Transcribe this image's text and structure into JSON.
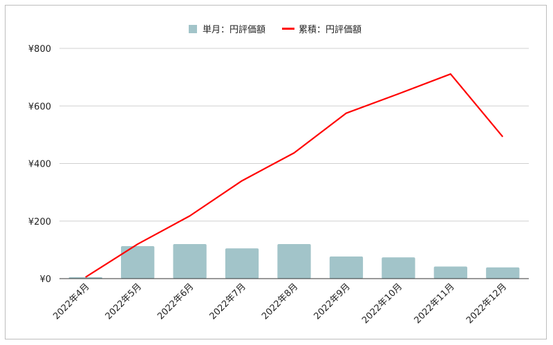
{
  "chart_data": {
    "type": "bar",
    "categories": [
      "2022年4月",
      "2022年5月",
      "2022年6月",
      "2022年7月",
      "2022年8月",
      "2022年9月",
      "2022年10月",
      "2022年11月",
      "2022年12月"
    ],
    "series": [
      {
        "name": "単月：円評価額",
        "type": "bar",
        "color": "#a2c4c9",
        "values": [
          5,
          113,
          120,
          105,
          120,
          77,
          74,
          42,
          39
        ]
      },
      {
        "name": "累積：円評価額",
        "type": "line",
        "color": "#ff0000",
        "values": [
          5,
          120,
          218,
          340,
          437,
          575,
          642,
          711,
          493
        ]
      }
    ],
    "y_ticks": [
      "¥0",
      "¥200",
      "¥400",
      "¥600",
      "¥800"
    ],
    "ylim": [
      0,
      800
    ],
    "grid": true,
    "legend_position": "top-center"
  }
}
